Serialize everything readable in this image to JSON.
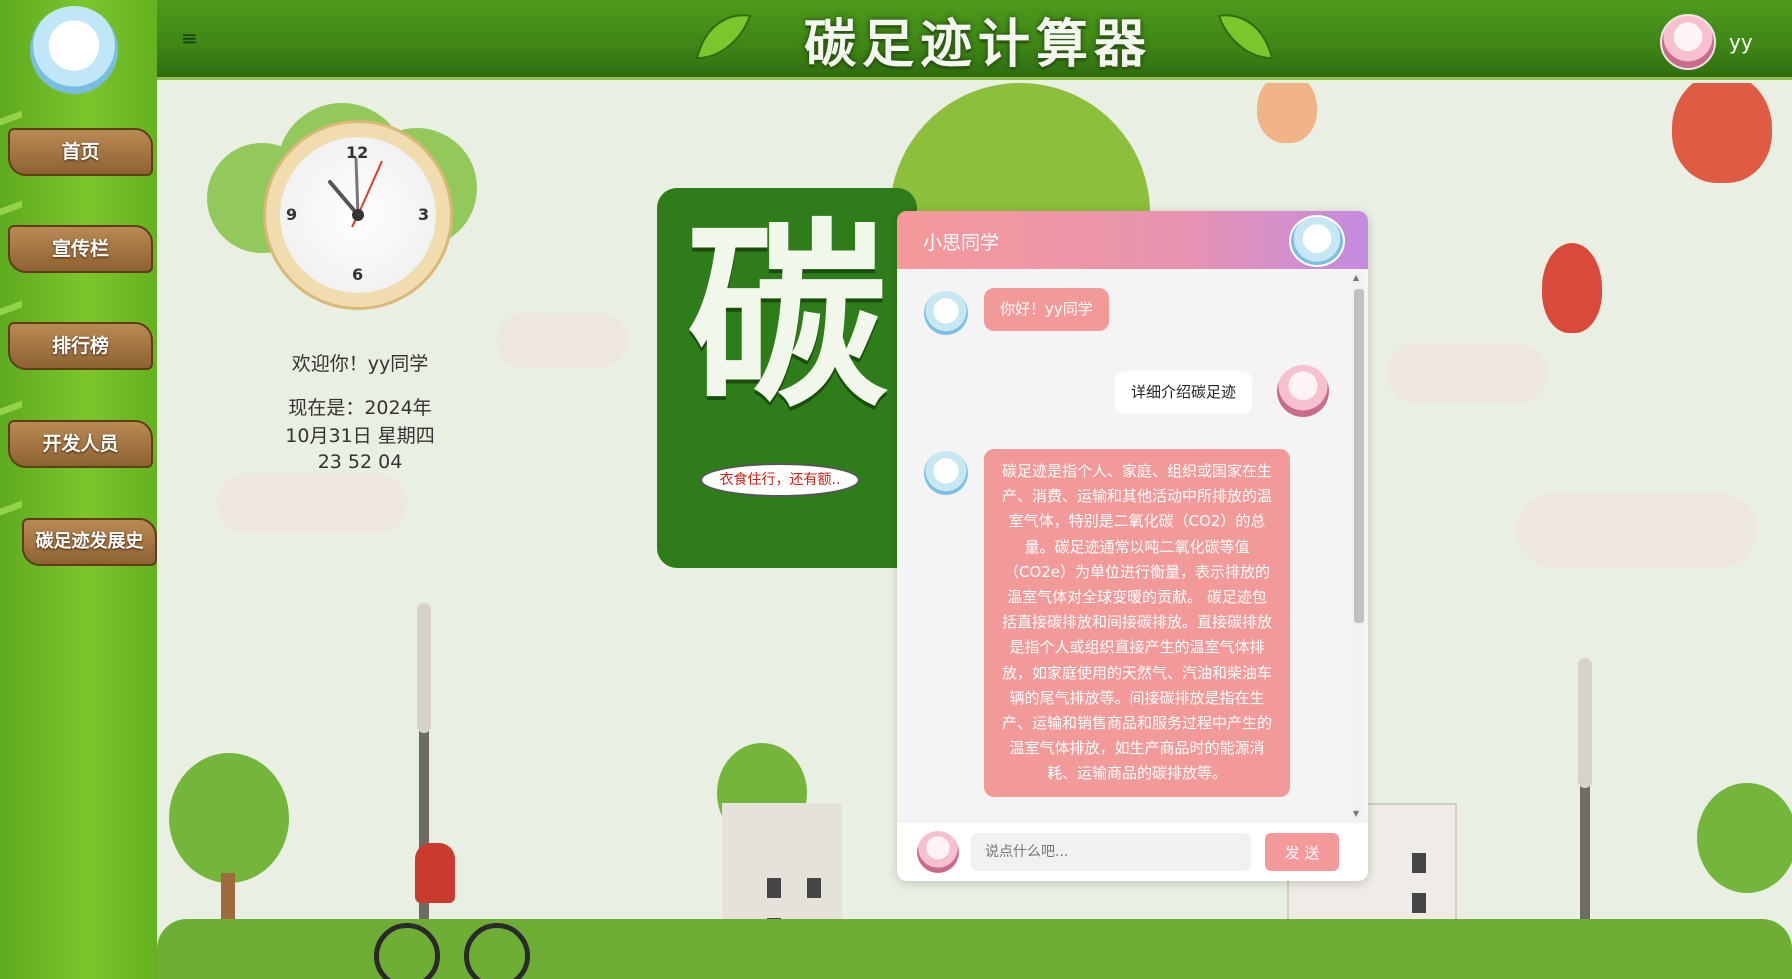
{
  "header": {
    "menu_icon": "hamburger-menu-icon",
    "title": "碳足迹计算器",
    "user_name": "yy"
  },
  "sidebar": {
    "items": [
      {
        "label": "首页"
      },
      {
        "label": "宣传栏"
      },
      {
        "label": "排行榜"
      },
      {
        "label": "开发人员"
      },
      {
        "label": "碳足迹发展史"
      }
    ]
  },
  "clock": {
    "numerals": [
      "12",
      "3",
      "6",
      "9"
    ]
  },
  "welcome": {
    "greeting": "欢迎你！yy同学",
    "now_label": "现在是：2024年",
    "date": "10月31日 星期四",
    "time": "23  52  04"
  },
  "scene": {
    "big_sign_text": "碳",
    "speech_bubble": "衣食住行，还有额.."
  },
  "chat": {
    "title": "小思同学",
    "messages": [
      {
        "from": "bot",
        "text": "你好！yy同学"
      },
      {
        "from": "user",
        "text": "详细介绍碳足迹"
      },
      {
        "from": "bot",
        "text": "碳足迹是指个人、家庭、组织或国家在生产、消费、运输和其他活动中所排放的温室气体，特别是二氧化碳（CO2）的总量。碳足迹通常以吨二氧化碳等值（CO2e）为单位进行衡量，表示排放的温室气体对全球变暖的贡献。 碳足迹包括直接碳排放和间接碳排放。直接碳排放是指个人或组织直接产生的温室气体排放，如家庭使用的天然气、汽油和柴油车辆的尾气排放等。间接碳排放是指在生产、运输和销售商品和服务过程中产生的温室气体排放，如生产商品时的能源消耗、运输商品的碳排放等。"
      }
    ],
    "input_placeholder": "说点什么吧...",
    "send_label": "发 送"
  },
  "colors": {
    "header_green": "#3f8616",
    "chat_accent": "#f29a9a",
    "chat_header_end": "#c48be0"
  }
}
